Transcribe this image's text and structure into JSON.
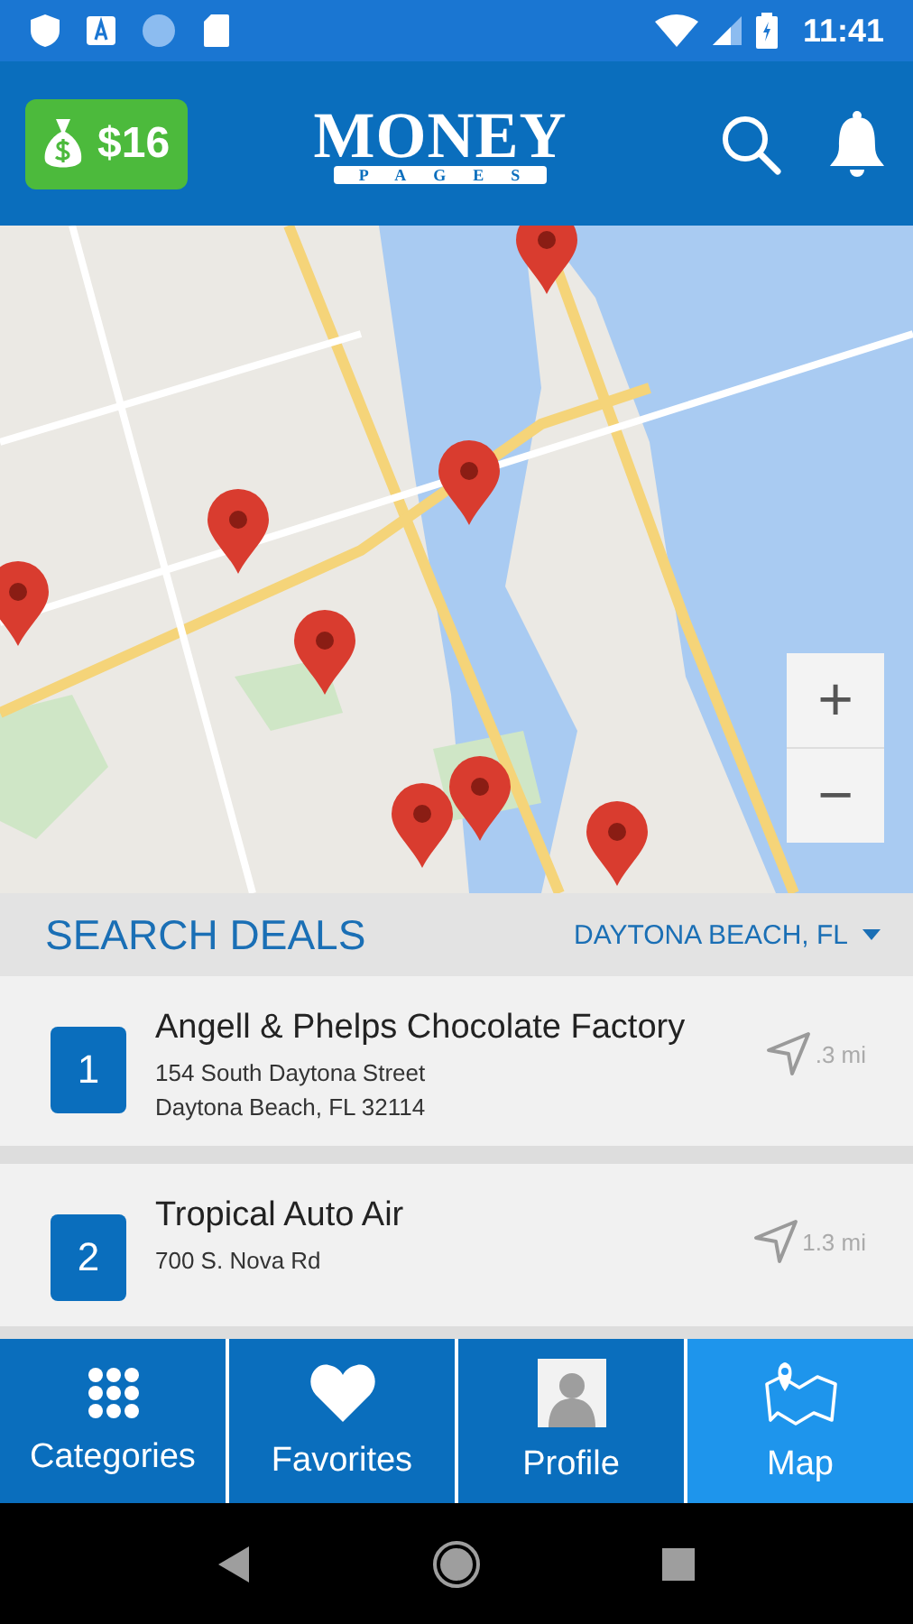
{
  "status_bar": {
    "time": "11:41"
  },
  "header": {
    "balance": "$16",
    "logo": {
      "top": "MONEY",
      "bottom": "PAGES"
    }
  },
  "map": {
    "kind": "picture",
    "zoom_in": "+",
    "zoom_out": "−"
  },
  "search": {
    "title": "SEARCH DEALS",
    "location": "DAYTONA BEACH, FL"
  },
  "deals": [
    {
      "number": "1",
      "name": "Angell & Phelps Chocolate Factory",
      "address": "154 South Daytona Street",
      "city": "Daytona Beach, FL 32114",
      "distance": ".3 mi"
    },
    {
      "number": "2",
      "name": "Tropical Auto Air",
      "address": "700 S. Nova Rd",
      "distance": "1.3 mi"
    }
  ],
  "tabs": [
    {
      "label": "Categories",
      "kind": "grid",
      "selected": false
    },
    {
      "label": "Favorites",
      "kind": "heart",
      "selected": false
    },
    {
      "label": "Profile",
      "kind": "avatar",
      "selected": false
    },
    {
      "label": "Map",
      "kind": "map",
      "selected": true
    }
  ]
}
